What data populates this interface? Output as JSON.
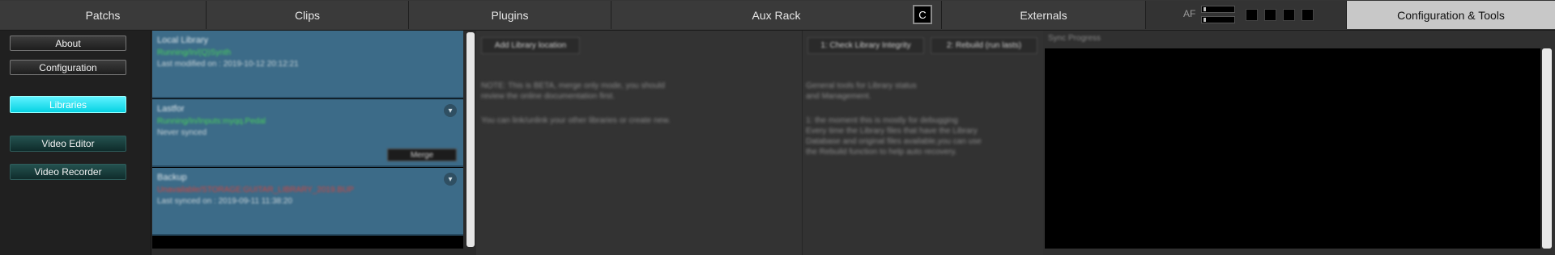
{
  "tabs": {
    "patchs": "Patchs",
    "clips": "Clips",
    "plugins": "Plugins",
    "aux_rack": "Aux Rack",
    "c_button": "C",
    "externals": "Externals",
    "af": "AF",
    "config_tools": "Configuration & Tools"
  },
  "sidebar": {
    "about": "About",
    "configuration": "Configuration",
    "libraries": "Libraries",
    "video_editor": "Video Editor",
    "video_recorder": "Video Recorder"
  },
  "libraries": [
    {
      "title": "Local Library",
      "status": "Running/In/(Q)Synth",
      "status_color": "#49d25a",
      "detail": "Last modified on : 2019-10-12 20:12:21"
    },
    {
      "title": "Lastfor",
      "status": "Running/In/Inputs:myqq.Pedal",
      "status_color": "#49d25a",
      "detail": "Never synced",
      "merge": "Merge"
    },
    {
      "title": "Backup",
      "status": "Unavailable/STORAGE:GUITAR_LIBRARY_2019.BUP",
      "status_color": "#d2453f",
      "detail": "Last synced on : 2019-09-11 11:38:20"
    }
  ],
  "middle": {
    "add_button": "Add Library location",
    "note_line1": "NOTE: This is BETA, merge only mode, you should",
    "note_line2": "review the online documentation first.",
    "note_line3": "You can link/unlink your other libraries or create new."
  },
  "right": {
    "check_button": "1: Check Library Integrity",
    "rebuild_button": "2: Rebuild (run lasts)",
    "text_lines": [
      "General tools for Library status",
      "and Management.",
      "",
      "1: the moment this is mostly for debugging",
      "Every time the Library files that have the Library",
      "Database and original files available,you can use",
      "the Rebuild function to help auto recovery."
    ]
  },
  "sync": {
    "label": "Sync Progress"
  },
  "colors": {
    "accent": "#06d2e2",
    "active_tab": "#c8c8c8",
    "card": "#3c6b88"
  }
}
